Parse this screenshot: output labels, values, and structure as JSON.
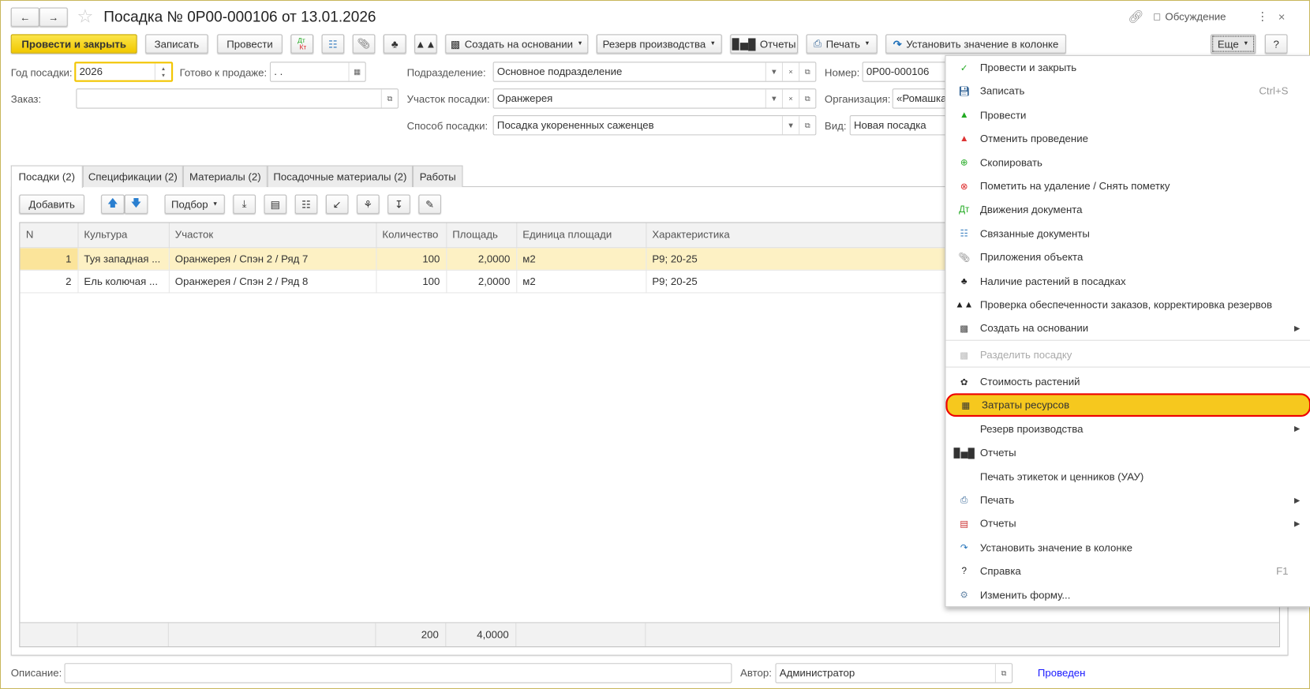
{
  "window": {
    "title": "Посадка № 0Р00-000106 от 13.01.2026",
    "discussion": "Обсуждение"
  },
  "toolbar": {
    "post_close": "Провести и закрыть",
    "save": "Записать",
    "post": "Провести",
    "create_based": "Создать на основании",
    "reserve": "Резерв производства",
    "reports": "Отчеты",
    "print": "Печать",
    "set_value": "Установить значение в колонке",
    "more": "Еще",
    "help": "?"
  },
  "form": {
    "year_label": "Год посадки:",
    "year_value": "2026",
    "ready_label": "Готово к продаже:",
    "ready_value": " .  .",
    "dept_label": "Подразделение:",
    "dept_value": "Основное подразделение",
    "number_label": "Номер:",
    "number_value": "0Р00-000106",
    "order_label": "Заказ:",
    "order_value": "",
    "plot_label": "Участок посадки:",
    "plot_value": "Оранжерея",
    "org_label": "Организация:",
    "org_value": "«Ромашка",
    "method_label": "Способ посадки:",
    "method_value": "Посадка укорененных саженцев",
    "kind_label": "Вид:",
    "kind_value": "Новая посадка"
  },
  "tabs": [
    "Посадки (2)",
    "Спецификации (2)",
    "Материалы (2)",
    "Посадочные материалы (2)",
    "Работы"
  ],
  "table_toolbar": {
    "add": "Добавить",
    "pick": "Подбор"
  },
  "table": {
    "columns": [
      "N",
      "Культура",
      "Участок",
      "Количество",
      "Площадь",
      "Единица площади",
      "Характеристика"
    ],
    "rows": [
      [
        "1",
        "Туя западная ...",
        "Оранжерея / Спэн 2 / Ряд 7",
        "100",
        "2,0000",
        "м2",
        "Р9; 20-25"
      ],
      [
        "2",
        "Ель колючая ...",
        "Оранжерея / Спэн 2 / Ряд 8",
        "100",
        "2,0000",
        "м2",
        "Р9; 20-25"
      ]
    ],
    "totals": {
      "quantity": "200",
      "area": "4,0000"
    }
  },
  "bottom": {
    "desc_label": "Описание:",
    "desc_value": "",
    "author_label": "Автор:",
    "author_value": "Администратор",
    "status": "Проведен"
  },
  "menu": {
    "items": [
      {
        "label": "Провести и закрыть",
        "icon": "post-close-icon"
      },
      {
        "label": "Записать",
        "icon": "save-icon",
        "shortcut": "Ctrl+S"
      },
      {
        "label": "Провести",
        "icon": "post-icon"
      },
      {
        "label": "Отменить проведение",
        "icon": "unpost-icon"
      },
      {
        "label": "Скопировать",
        "icon": "copy-icon"
      },
      {
        "label": "Пометить на удаление / Снять пометку",
        "icon": "delete-mark-icon"
      },
      {
        "label": "Движения документа",
        "icon": "dt-kt-icon"
      },
      {
        "label": "Связанные документы",
        "icon": "related-docs-icon"
      },
      {
        "label": "Приложения объекта",
        "icon": "paperclip-icon"
      },
      {
        "label": "Наличие растений в посадках",
        "icon": "plants-icon"
      },
      {
        "label": "Проверка обеспеченности заказов, корректировка резервов",
        "icon": "trees-icon"
      },
      {
        "label": "Создать на основании",
        "icon": "create-based-icon",
        "submenu": true
      },
      {
        "label": "Разделить посадку",
        "icon": "split-icon",
        "disabled": true
      },
      {
        "label": "Стоимость растений",
        "icon": "flower-icon"
      },
      {
        "label": "Затраты ресурсов",
        "icon": "tree-structure-icon",
        "highlighted": true
      },
      {
        "label": "Резерв производства",
        "submenu": true
      },
      {
        "label": "Отчеты",
        "icon": "bar-chart-icon"
      },
      {
        "label": "Печать этикеток и ценников (УАУ)"
      },
      {
        "label": "Печать",
        "icon": "printer-icon",
        "submenu": true
      },
      {
        "label": "Отчеты",
        "icon": "report-icon",
        "submenu": true
      },
      {
        "label": "Установить значение в колонке",
        "icon": "curved-arrow-icon"
      },
      {
        "label": "Справка",
        "icon": "question-icon",
        "shortcut": "F1"
      },
      {
        "label": "Изменить форму...",
        "icon": "form-settings-icon"
      }
    ]
  },
  "colors": {
    "accent": "#f1c800",
    "highlight": "#f6c81e",
    "highlight_border": "#e00000",
    "status": "#0000ff",
    "selected_row": "#fdf1c4"
  }
}
